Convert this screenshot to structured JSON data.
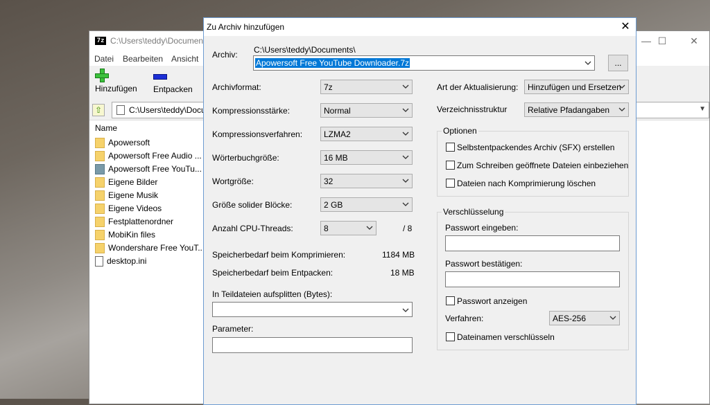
{
  "fm": {
    "title": "C:\\Users\\teddy\\Documents\\",
    "app_icon_text": "7z",
    "minimize": "—",
    "maximize": "☐",
    "close": "✕",
    "menu": [
      "Datei",
      "Bearbeiten",
      "Ansicht"
    ],
    "toolbar": {
      "add_label": "Hinzufügen",
      "extract_label": "Entpacken"
    },
    "address": "C:\\Users\\teddy\\Documents\\",
    "column_name": "Name",
    "files": [
      {
        "name": "Apowersoft",
        "type": "folder"
      },
      {
        "name": "Apowersoft Free Audio ...",
        "type": "folder"
      },
      {
        "name": "Apowersoft Free YouTu...",
        "type": "app-folder"
      },
      {
        "name": "Eigene Bilder",
        "type": "folder"
      },
      {
        "name": "Eigene Musik",
        "type": "folder"
      },
      {
        "name": "Eigene Videos",
        "type": "folder"
      },
      {
        "name": "Festplattenordner",
        "type": "folder"
      },
      {
        "name": "MobiKin files",
        "type": "folder"
      },
      {
        "name": "Wondershare Free YouT...",
        "type": "folder"
      },
      {
        "name": "desktop.ini",
        "type": "ini"
      }
    ]
  },
  "dialog": {
    "title": "Zu Archiv hinzufügen",
    "close": "✕",
    "archive_label": "Archiv:",
    "archive_path": "C:\\Users\\teddy\\Documents\\",
    "archive_name": "Apowersoft Free YouTube Downloader.7z",
    "browse_label": "...",
    "left": {
      "format_label": "Archivformat:",
      "format_value": "7z",
      "level_label": "Kompressionsstärke:",
      "level_value": "Normal",
      "method_label": "Kompressionsverfahren:",
      "method_value": "LZMA2",
      "dict_label": "Wörterbuchgröße:",
      "dict_value": "16 MB",
      "word_label": "Wortgröße:",
      "word_value": "32",
      "solid_label": "Größe solider Blöcke:",
      "solid_value": "2 GB",
      "threads_label": "Anzahl CPU-Threads:",
      "threads_value": "8",
      "threads_max": "/ 8",
      "mem_compress_label": "Speicherbedarf beim Komprimieren:",
      "mem_compress_value": "1184 MB",
      "mem_extract_label": "Speicherbedarf beim Entpacken:",
      "mem_extract_value": "18 MB",
      "split_label": "In Teildateien aufsplitten (Bytes):",
      "split_value": "",
      "params_label": "Parameter:",
      "params_value": ""
    },
    "right": {
      "update_label": "Art der Aktualisierung:",
      "update_value": "Hinzufügen und Ersetzen",
      "paths_label": "Verzeichnisstruktur",
      "paths_value": "Relative Pfadangaben",
      "options_title": "Optionen",
      "opt_sfx": "Selbstentpackendes Archiv (SFX) erstellen",
      "opt_shared": "Zum Schreiben geöffnete Dateien einbeziehen",
      "opt_delete": "Dateien nach Komprimierung löschen",
      "encryption_title": "Verschlüsselung",
      "pwd_label": "Passwort eingeben:",
      "pwd_confirm_label": "Passwort bestätigen:",
      "show_pwd_label": "Passwort anzeigen",
      "method_label": "Verfahren:",
      "method_value": "AES-256",
      "encrypt_names_label": "Dateinamen verschlüsseln"
    }
  }
}
